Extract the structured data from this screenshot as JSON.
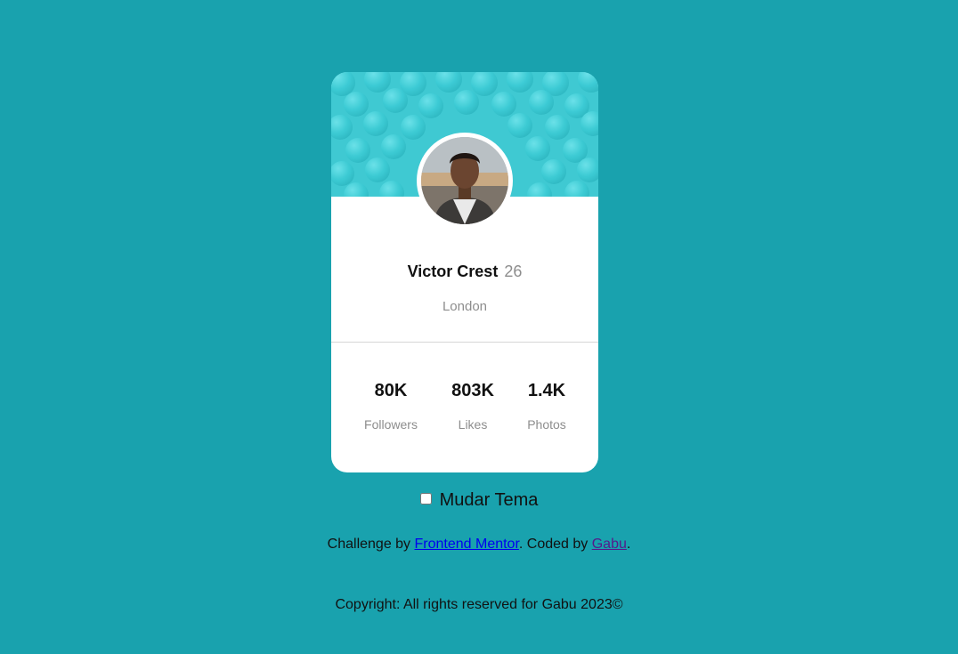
{
  "colors": {
    "background": "#19a2ae",
    "card": "#ffffff",
    "header_pattern": "#3fc9d2",
    "muted_text": "#8d8d8d",
    "link": "#0000ee",
    "visited_link": "#551a8b"
  },
  "profile": {
    "name": "Victor Crest",
    "age": "26",
    "city": "London",
    "avatar_icon": "profile-photo"
  },
  "stats": [
    {
      "value": "80K",
      "label": "Followers"
    },
    {
      "value": "803K",
      "label": "Likes"
    },
    {
      "value": "1.4K",
      "label": "Photos"
    }
  ],
  "theme_toggle": {
    "label": "Mudar Tema",
    "checked": false
  },
  "attribution": {
    "prefix": "Challenge by ",
    "challenge_link": "Frontend Mentor",
    "middle": ". Coded by ",
    "author_link": "Gabu",
    "suffix": "."
  },
  "copyright": "Copyright: All rights reserved for Gabu 2023©"
}
